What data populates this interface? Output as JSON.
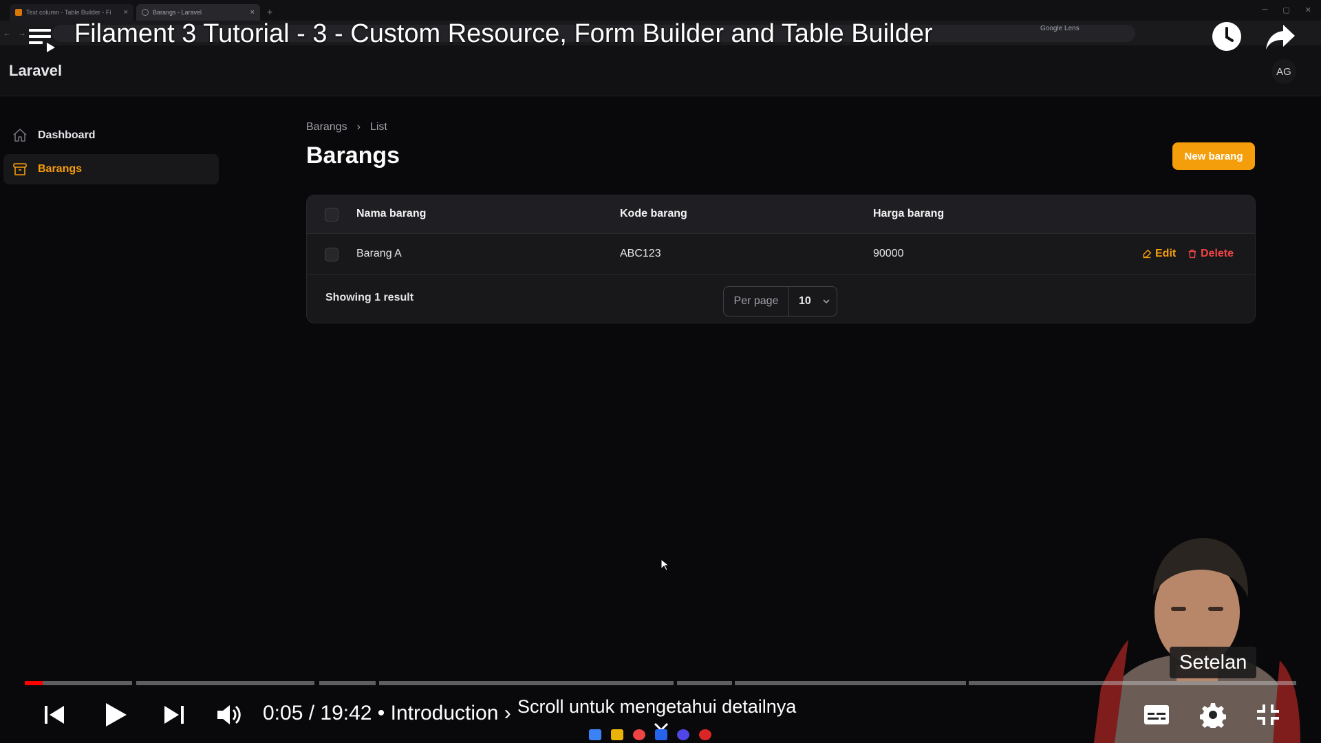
{
  "browser": {
    "tabs": [
      {
        "label": "Text column - Table Builder - Fi"
      },
      {
        "label": "Barangs - Laravel"
      }
    ],
    "new_tab": "+",
    "lens_label": "Google Lens"
  },
  "video": {
    "title": "Filament 3 Tutorial - 3 - Custom Resource, Form Builder and Table Builder",
    "time": "0:05 / 19:42 • Introduction ›",
    "scroll_hint": "Scroll untuk mengetahui detailnya",
    "tooltip": "Setelan",
    "progress": 0.004
  },
  "app": {
    "brand": "Laravel",
    "avatar_initials": "AG",
    "sidebar": {
      "items": [
        {
          "label": "Dashboard",
          "icon": "home-icon",
          "active": false
        },
        {
          "label": "Barangs",
          "icon": "archive-box-icon",
          "active": true
        }
      ]
    },
    "breadcrumb": {
      "items": [
        "Barangs",
        "List"
      ],
      "separator": "›"
    },
    "page_title": "Barangs",
    "new_button": "New barang",
    "table": {
      "columns": [
        "Nama barang",
        "Kode barang",
        "Harga barang"
      ],
      "rows": [
        {
          "nama": "Barang A",
          "kode": "ABC123",
          "harga": "90000"
        }
      ],
      "actions": {
        "edit": "Edit",
        "delete": "Delete"
      },
      "footer_text": "Showing 1 result",
      "per_page_label": "Per page",
      "per_page_value": "10"
    }
  },
  "colors": {
    "accent": "#f59e0b",
    "danger": "#ef4444",
    "youtube_red": "#ff0000",
    "background": "#09090b"
  }
}
